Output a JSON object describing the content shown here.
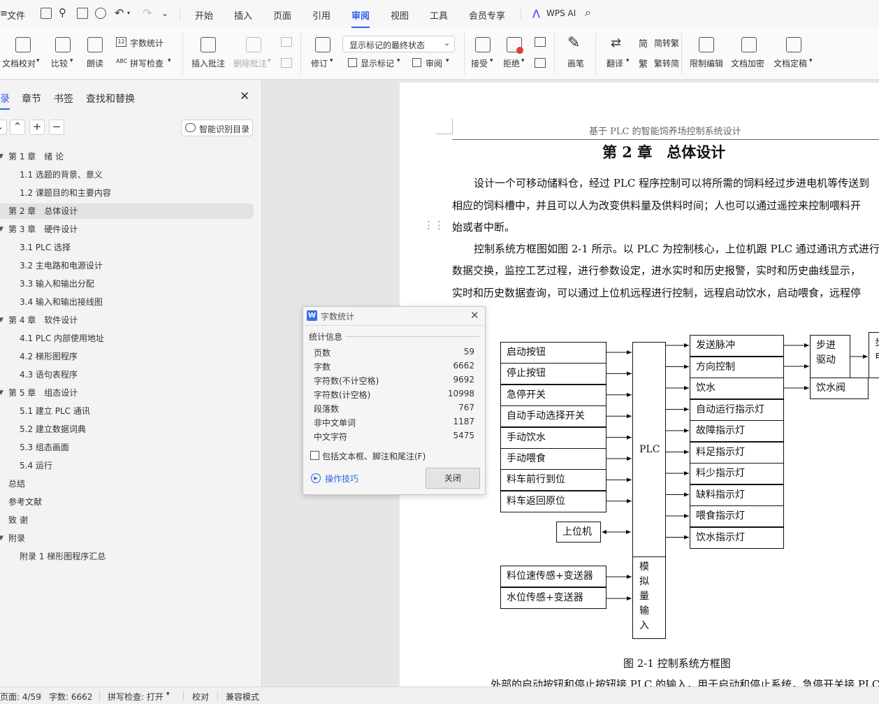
{
  "menubar": {
    "file_label": "文件",
    "tabs": [
      "开始",
      "插入",
      "页面",
      "引用",
      "审阅",
      "视图",
      "工具",
      "会员专享"
    ],
    "active_tab": "审阅",
    "wps_ai": "WPS AI"
  },
  "ribbon": {
    "doc_check": "文档校对",
    "compare": "比较",
    "read_aloud": "朗读",
    "word_count": "字数统计",
    "spell_check": "拼写检查",
    "insert_comment": "插入批注",
    "delete_comment": "删除批注",
    "revise": "修订",
    "markup_state": "显示标记的最终状态",
    "show_markup": "显示标记",
    "review": "审阅",
    "accept": "接受",
    "reject": "拒绝",
    "ink": "画笔",
    "translate": "翻译",
    "to_traditional": "简转繁",
    "to_simplified": "繁转简",
    "restrict_edit": "限制编辑",
    "doc_encrypt": "文档加密",
    "doc_finalize": "文档定稿"
  },
  "nav": {
    "tabs": [
      "录",
      "章节",
      "书签",
      "查找和替换"
    ],
    "smart_toc": "智能识别目录",
    "toc": [
      {
        "text": "第 1 章　绪  论",
        "level": 1,
        "arrow": true
      },
      {
        "text": "1.1 选题的背景、意义",
        "level": 2
      },
      {
        "text": "1.2 课题目的和主要内容",
        "level": 2
      },
      {
        "text": "第 2 章　总体设计",
        "level": 1,
        "selected": true
      },
      {
        "text": "第 3 章　硬件设计",
        "level": 1,
        "arrow": true
      },
      {
        "text": "3.1 PLC 选择",
        "level": 2
      },
      {
        "text": "3.2  主电路和电源设计",
        "level": 2
      },
      {
        "text": "3.3  输入和输出分配",
        "level": 2
      },
      {
        "text": "3.4  输入和输出接线图",
        "level": 2
      },
      {
        "text": "第 4 章　软件设计",
        "level": 1,
        "arrow": true
      },
      {
        "text": "4.1 PLC 内部使用地址",
        "level": 2
      },
      {
        "text": "4.2  梯形图程序",
        "level": 2
      },
      {
        "text": "4.3  语句表程序",
        "level": 2
      },
      {
        "text": "第 5 章　组态设计",
        "level": 1,
        "arrow": true
      },
      {
        "text": "5.1 建立 PLC 通讯",
        "level": 2
      },
      {
        "text": "5.2  建立数据词典",
        "level": 2
      },
      {
        "text": "5.3  组态画面",
        "level": 2
      },
      {
        "text": "5.4 运行",
        "level": 2
      },
      {
        "text": "总结",
        "level": 1
      },
      {
        "text": "参考文献",
        "level": 1
      },
      {
        "text": "致  谢",
        "level": 1
      },
      {
        "text": "附录",
        "level": 1,
        "arrow": true
      },
      {
        "text": "附录 1  梯形图程序汇总",
        "level": 2
      }
    ]
  },
  "doc": {
    "header": "基于 PLC 的智能饲养场控制系统设计",
    "chapter_title": "第 2 章　总体设计",
    "para1": [
      "设计一个可移动储料仓，经过 PLC 程序控制可以将所需的饲料经过步进电机等传送到",
      "相应的饲料槽中，并且可以人为改变供料量及供料时间；人也可以通过遥控来控制喂料开",
      "始或者中断。"
    ],
    "para2": [
      "控制系统方框图如图 2-1 所示。以 PLC 为控制核心，上位机跟 PLC 通过通讯方式进行",
      "数据交换，监控工艺过程，进行参数设定，进水实时和历史报警，实时和历史曲线显示，",
      "实时和历史数据查询，可以通过上位机远程进行控制，远程启动饮水，启动喂食，远程停"
    ],
    "diagram": {
      "inputs": [
        "启动按钮",
        "停止按钮",
        "急停开关",
        "自动手动选择开关",
        "手动饮水",
        "手动喂食",
        "料车前行到位",
        "料车返回原位"
      ],
      "plc": "PLC",
      "host": "上位机",
      "analog_inputs": [
        "料位速传感+变送器",
        "水位传感+变送器"
      ],
      "analog_block": "模拟量输入",
      "outputs": [
        "发送脉冲",
        "方向控制",
        "饮水",
        "自动运行指示灯",
        "故障指示灯",
        "料足指示灯",
        "料少指示灯",
        "缺料指示灯",
        "喂食指示灯",
        "饮水指示灯"
      ],
      "stepper": "步进驱动",
      "valve": "饮水阀",
      "motor_partial": "步电"
    },
    "caption": "图 2-1 控制系统方框图",
    "para3": "外部的启动按钮和停止按钮接 PLC 的输入，用于启动和停止系统，急停开关接 PLC"
  },
  "dialog": {
    "title": "字数统计",
    "section": "统计信息",
    "rows": [
      {
        "label": "页数",
        "value": "59"
      },
      {
        "label": "字数",
        "value": "6662"
      },
      {
        "label": "字符数(不计空格)",
        "value": "9692"
      },
      {
        "label": "字符数(计空格)",
        "value": "10998"
      },
      {
        "label": "段落数",
        "value": "767"
      },
      {
        "label": "非中文单词",
        "value": "1187"
      },
      {
        "label": "中文字符",
        "value": "5475"
      }
    ],
    "checkbox_label": "包括文本框、脚注和尾注(F)",
    "tips": "操作技巧",
    "close": "关闭"
  },
  "status": {
    "page": "页面: 4/59",
    "words": "字数: 6662",
    "spell": "拼写检查: 打开",
    "proof": "校对",
    "compat": "兼容模式"
  },
  "colors": {
    "accent": "#2f63e8"
  }
}
